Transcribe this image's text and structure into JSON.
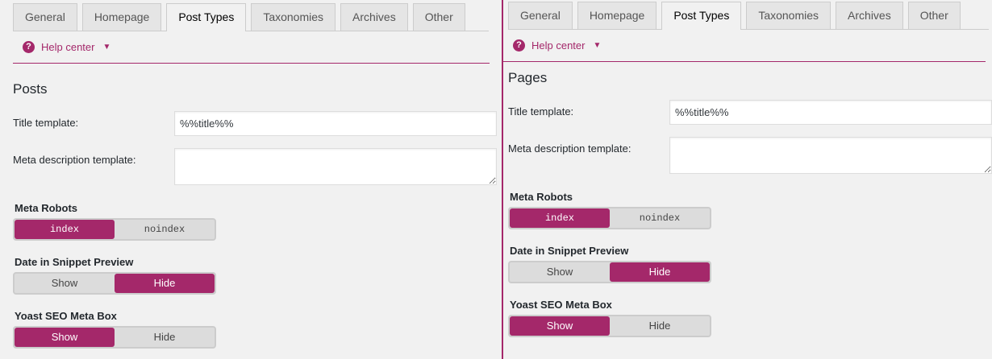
{
  "colors": {
    "accent": "#a4286a"
  },
  "panels": [
    {
      "tabs": [
        "General",
        "Homepage",
        "Post Types",
        "Taxonomies",
        "Archives",
        "Other"
      ],
      "active_tab": "Post Types",
      "help_label": "Help center",
      "section_title": "Posts",
      "title_template_label": "Title template:",
      "title_template_value": "%%title%%",
      "meta_description_label": "Meta description template:",
      "meta_description_value": "",
      "switches": [
        {
          "title": "Meta Robots",
          "options": [
            "index",
            "noindex"
          ],
          "selected": "index",
          "mono": true
        },
        {
          "title": "Date in Snippet Preview",
          "options": [
            "Show",
            "Hide"
          ],
          "selected": "Hide",
          "mono": false
        },
        {
          "title": "Yoast SEO Meta Box",
          "options": [
            "Show",
            "Hide"
          ],
          "selected": "Show",
          "mono": false
        }
      ]
    },
    {
      "tabs": [
        "General",
        "Homepage",
        "Post Types",
        "Taxonomies",
        "Archives",
        "Other"
      ],
      "active_tab": "Post Types",
      "help_label": "Help center",
      "section_title": "Pages",
      "title_template_label": "Title template:",
      "title_template_value": "%%title%%",
      "meta_description_label": "Meta description template:",
      "meta_description_value": "",
      "switches": [
        {
          "title": "Meta Robots",
          "options": [
            "index",
            "noindex"
          ],
          "selected": "index",
          "mono": true
        },
        {
          "title": "Date in Snippet Preview",
          "options": [
            "Show",
            "Hide"
          ],
          "selected": "Hide",
          "mono": false
        },
        {
          "title": "Yoast SEO Meta Box",
          "options": [
            "Show",
            "Hide"
          ],
          "selected": "Show",
          "mono": false
        }
      ]
    }
  ]
}
